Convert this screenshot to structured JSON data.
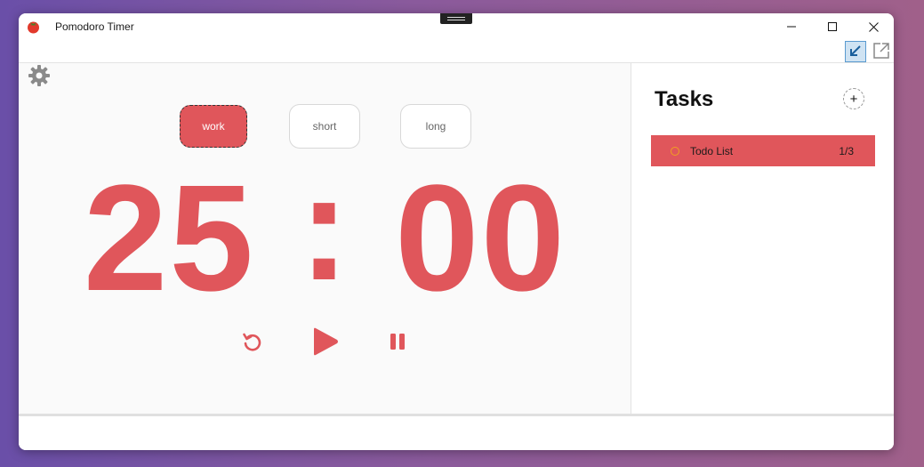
{
  "window": {
    "title": "Pomodoro Timer"
  },
  "colors": {
    "accent": "#e0565b",
    "task_dot": "#f0a020"
  },
  "modes": [
    {
      "label": "work",
      "selected": true
    },
    {
      "label": "short",
      "selected": false
    },
    {
      "label": "long",
      "selected": false
    }
  ],
  "timer": {
    "minutes": "25",
    "separator": ":",
    "seconds": "00"
  },
  "controls": {
    "reset_icon": "reset-icon",
    "play_icon": "play-icon",
    "pause_icon": "pause-icon"
  },
  "tasks": {
    "title": "Tasks",
    "add_label": "+",
    "items": [
      {
        "name": "Todo List",
        "progress": "1/3"
      }
    ]
  }
}
